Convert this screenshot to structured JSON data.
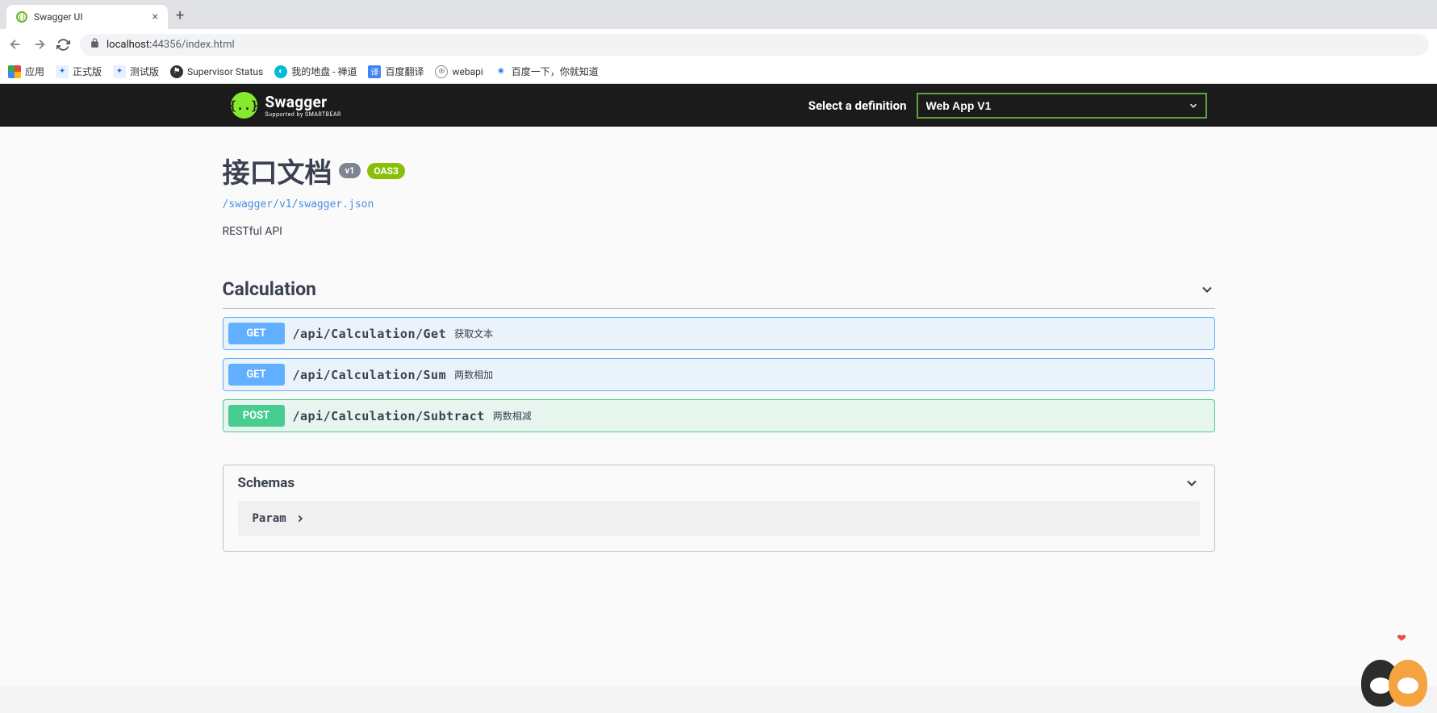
{
  "browser": {
    "tab_title": "Swagger UI",
    "url_host": "localhost:",
    "url_port": "44356",
    "url_path": "/index.html",
    "bookmarks": [
      {
        "label": "应用"
      },
      {
        "label": "正式版"
      },
      {
        "label": "测试版"
      },
      {
        "label": "Supervisor Status"
      },
      {
        "label": "我的地盘 - 禅道"
      },
      {
        "label": "百度翻译"
      },
      {
        "label": "webapi"
      },
      {
        "label": "百度一下，你就知道"
      }
    ]
  },
  "topbar": {
    "brand": "Swagger",
    "sub": "Supported by SMARTBEAR",
    "select_label": "Select a definition",
    "select_value": "Web App V1"
  },
  "info": {
    "title": "接口文档",
    "version_badge": "v1",
    "oas_badge": "OAS3",
    "json_link": "/swagger/v1/swagger.json",
    "description": "RESTful API"
  },
  "tags": [
    {
      "name": "Calculation",
      "operations": [
        {
          "method": "GET",
          "path": "/api/Calculation/Get",
          "summary": "获取文本"
        },
        {
          "method": "GET",
          "path": "/api/Calculation/Sum",
          "summary": "两数相加"
        },
        {
          "method": "POST",
          "path": "/api/Calculation/Subtract",
          "summary": "两数相减"
        }
      ]
    }
  ],
  "schemas": {
    "title": "Schemas",
    "items": [
      {
        "name": "Param"
      }
    ]
  }
}
